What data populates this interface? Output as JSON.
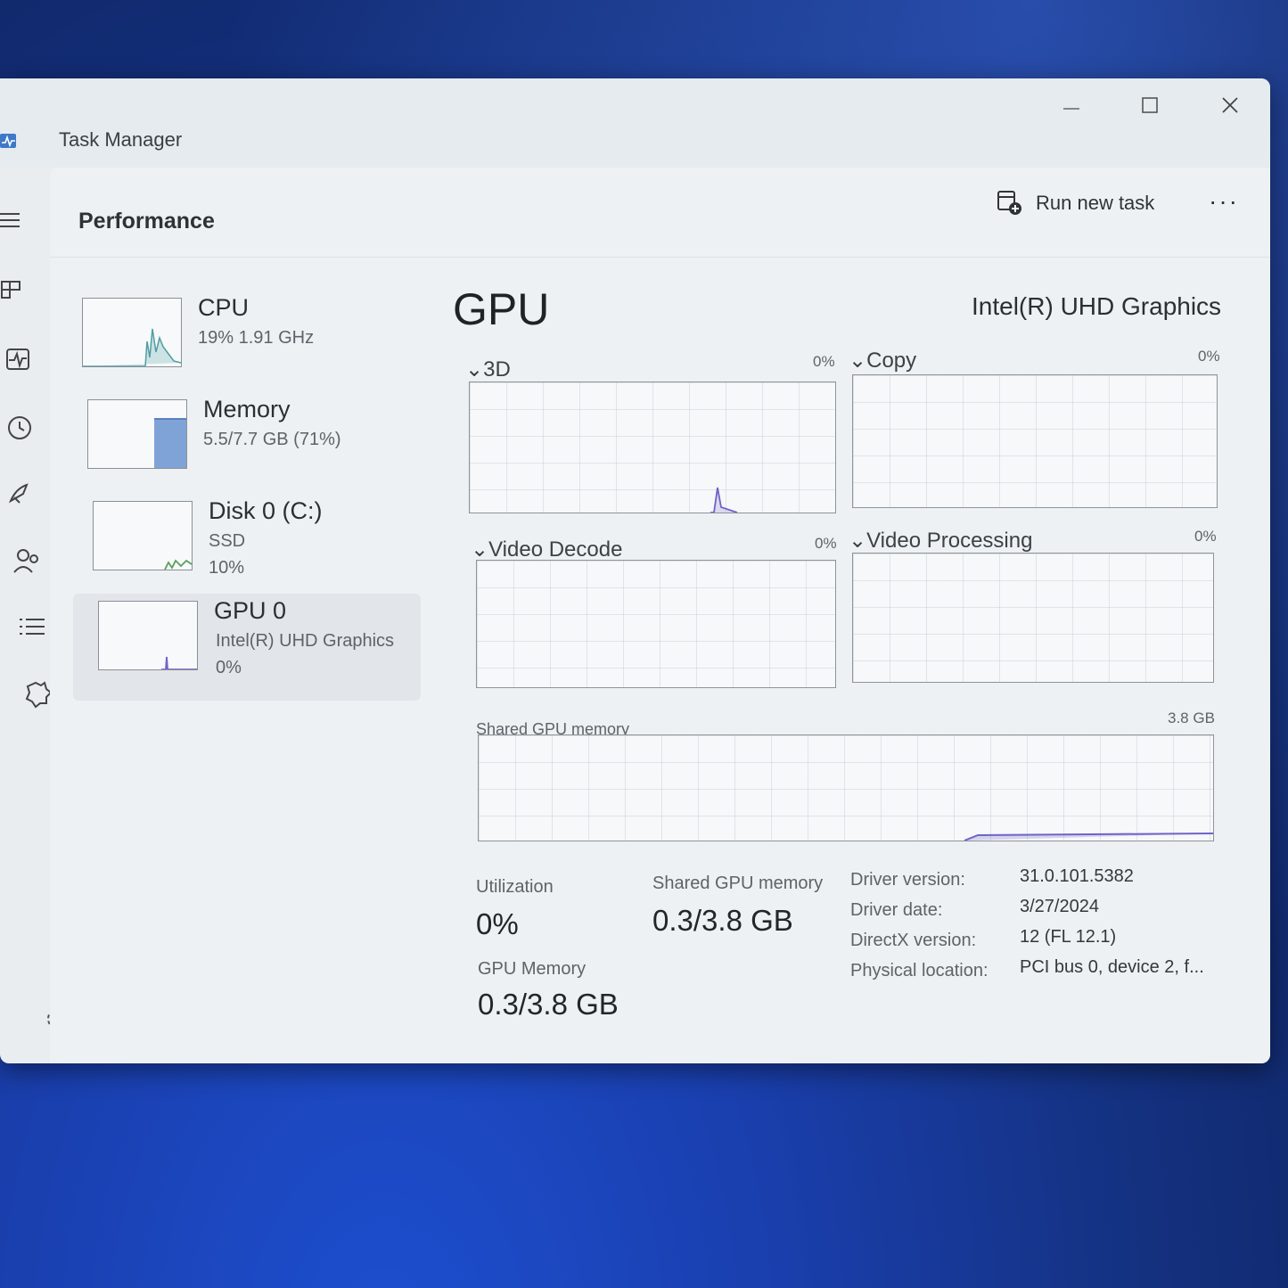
{
  "window": {
    "title": "Task Manager",
    "minimize_icon": "minimize-icon",
    "maximize_icon": "maximize-icon",
    "close_icon": "close-icon"
  },
  "header": {
    "page_title": "Performance",
    "run_new_task": "Run new task",
    "more_options": "···"
  },
  "nav": {
    "items": [
      "hamburger-icon",
      "processes-icon",
      "performance-icon",
      "app-history-icon",
      "startup-apps-icon",
      "users-icon",
      "details-icon",
      "services-icon",
      "settings-icon"
    ],
    "selected": "performance-icon"
  },
  "devices": [
    {
      "name": "CPU",
      "line1": "19%  1.91 GHz",
      "line2": ""
    },
    {
      "name": "Memory",
      "line1": "5.5/7.7 GB (71%)",
      "line2": ""
    },
    {
      "name": "Disk 0 (C:)",
      "line1": "SSD",
      "line2": "10%"
    },
    {
      "name": "GPU 0",
      "line1": "Intel(R) UHD Graphics",
      "line2": "0%"
    }
  ],
  "selected_device": "GPU 0",
  "memory_usage_percent": 71,
  "gpu": {
    "title": "GPU",
    "model": "Intel(R) UHD Graphics",
    "engines": [
      {
        "name": "3D",
        "value": "0%"
      },
      {
        "name": "Copy",
        "value": "0%"
      },
      {
        "name": "Video Decode",
        "value": "0%"
      },
      {
        "name": "Video Processing",
        "value": "0%"
      }
    ],
    "shared_memory_graph": {
      "label": "Shared GPU memory",
      "max": "3.8 GB"
    },
    "stats": {
      "utilization_label": "Utilization",
      "utilization_value": "0%",
      "shared_mem_label": "Shared GPU memory",
      "shared_mem_value": "0.3/3.8 GB",
      "gpu_mem_label": "GPU Memory",
      "gpu_mem_value": "0.3/3.8 GB"
    },
    "details": [
      {
        "key": "Driver version:",
        "value": "31.0.101.5382"
      },
      {
        "key": "Driver date:",
        "value": "3/27/2024"
      },
      {
        "key": "DirectX version:",
        "value": "12 (FL 12.1)"
      },
      {
        "key": "Physical location:",
        "value": "PCI bus 0, device 2, f..."
      }
    ]
  },
  "colors": {
    "cpu_line": "#4f9ea3",
    "memory_fill": "#7fa3d6",
    "disk_line": "#5aa05a",
    "gpu_line": "#6f63c8",
    "desktop": "#1a3fae"
  }
}
